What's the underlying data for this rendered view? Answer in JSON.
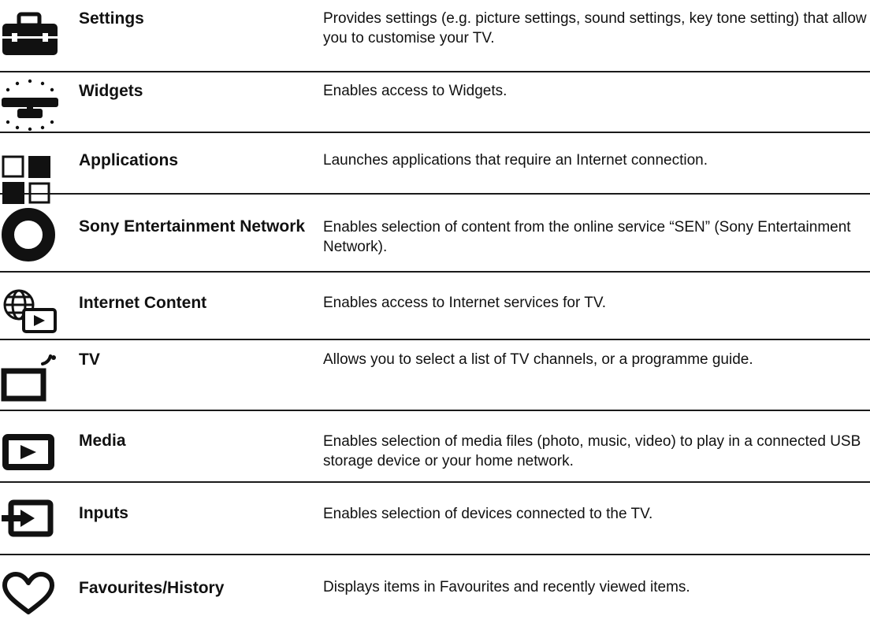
{
  "menu": [
    {
      "id": "settings",
      "icon": "toolbox-icon",
      "name": "Settings",
      "desc": "Provides settings (e.g. picture settings, sound settings, key tone setting) that allow you to customise your TV."
    },
    {
      "id": "widgets",
      "icon": "widgets-icon",
      "name": "Widgets",
      "desc": "Enables access to Widgets."
    },
    {
      "id": "applications",
      "icon": "applications-grid-icon",
      "name": "Applications",
      "desc": "Launches applications that require an Internet connection."
    },
    {
      "id": "sen",
      "icon": "ring-icon",
      "name": "Sony Entertainment Network",
      "desc": "Enables selection of content from the online service “SEN” (Sony Entertainment Network)."
    },
    {
      "id": "internet-content",
      "icon": "globe-play-icon",
      "name": "Internet Content",
      "desc": "Enables access to Internet services for TV."
    },
    {
      "id": "tv",
      "icon": "tv-broadcast-icon",
      "name": "TV",
      "desc": "Allows you to select a list of TV channels, or a programme guide."
    },
    {
      "id": "media",
      "icon": "play-box-icon",
      "name": "Media",
      "desc": "Enables selection of media files (photo, music, video) to play in a connected USB storage device or your home network."
    },
    {
      "id": "inputs",
      "icon": "input-arrow-icon",
      "name": "Inputs",
      "desc": "Enables selection of devices connected to the TV."
    },
    {
      "id": "favourites-history",
      "icon": "heart-icon",
      "name": "Favourites/History",
      "desc": "Displays items in Favourites and recently viewed items."
    }
  ]
}
